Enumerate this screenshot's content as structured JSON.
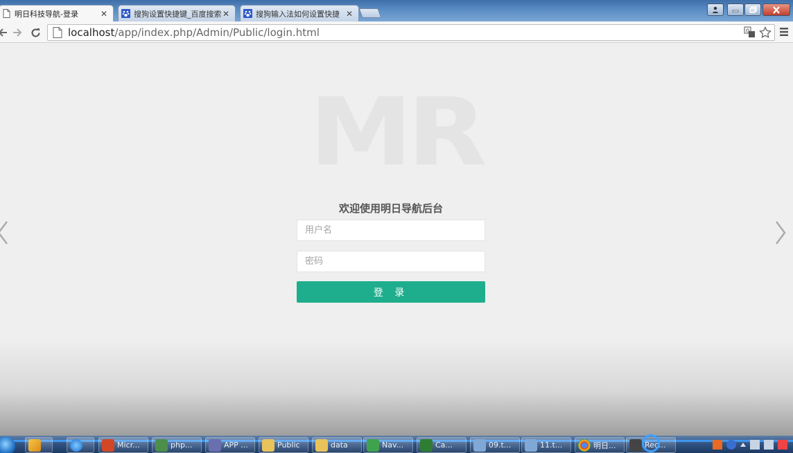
{
  "browser": {
    "tabs": [
      {
        "label": "明日科技导航-登录",
        "active": true,
        "icon": "page-icon"
      },
      {
        "label": "搜狗设置快捷键_百度搜索",
        "active": false,
        "icon": "baidu-paw-icon"
      },
      {
        "label": "搜狗输入法如何设置快捷",
        "active": false,
        "icon": "baidu-paw-icon"
      }
    ],
    "url_host": "localhost",
    "url_path": "/app/index.php/Admin/Public/login.html"
  },
  "login": {
    "logo_text": "MR",
    "welcome": "欢迎使用明日导航后台",
    "username_placeholder": "用户名",
    "password_placeholder": "密码",
    "submit_label": "登 录"
  },
  "taskbar": {
    "items": [
      {
        "label": "Micr...",
        "icon": "office-icon"
      },
      {
        "label": "php...",
        "icon": "terminal-icon"
      },
      {
        "label": "APP ...",
        "icon": "php-icon"
      },
      {
        "label": "Public",
        "icon": "folder-icon"
      },
      {
        "label": "data",
        "icon": "folder-icon"
      },
      {
        "label": "Nav...",
        "icon": "app-icon"
      },
      {
        "label": "Ca...",
        "icon": "camtasia-icon"
      },
      {
        "label": "09.t...",
        "icon": "document-icon"
      },
      {
        "label": "11.t...",
        "icon": "document-icon"
      },
      {
        "label": "明日...",
        "icon": "chrome-icon"
      },
      {
        "label": "Rec...",
        "icon": "recorder-icon"
      }
    ]
  },
  "colors": {
    "accent": "#1fae8d",
    "titlebar": "#5b8cc4",
    "taskbar": "#2f5180"
  }
}
